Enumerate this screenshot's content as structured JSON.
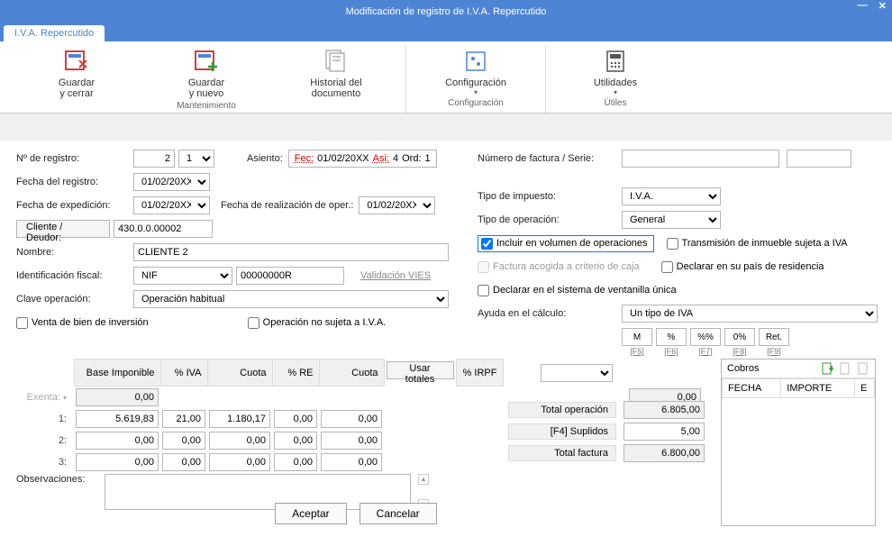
{
  "window": {
    "title": "Modificación de registro de I.V.A. Repercutido"
  },
  "tab": "I.V.A. Repercutido",
  "ribbon": {
    "mantenimiento": {
      "label": "Mantenimiento",
      "items": [
        {
          "l1": "Guardar",
          "l2": "y cerrar"
        },
        {
          "l1": "Guardar",
          "l2": "y nuevo"
        },
        {
          "l1": "Historial del",
          "l2": "documento"
        }
      ]
    },
    "config": {
      "label": "Configuración",
      "item": "Configuración"
    },
    "utiles": {
      "label": "Útiles",
      "item": "Utilidades"
    }
  },
  "form": {
    "nregistro_label": "Nº de registro:",
    "nregistro": "2",
    "nregistro_sub": "1",
    "asiento_label": "Asiento:",
    "asiento_fec_lbl": "Fec:",
    "asiento_fec": "01/02/20XX",
    "asiento_asi_lbl": "Asi:",
    "asiento_asi": "4",
    "asiento_ord_lbl": "Ord:",
    "asiento_ord": "1",
    "fecha_registro_label": "Fecha del registro:",
    "fecha_registro": "01/02/20XX",
    "fecha_exp_label": "Fecha de expedición:",
    "fecha_exp": "01/02/20XX",
    "fecha_oper_label": "Fecha de realización de oper.:",
    "fecha_oper": "01/02/20XX",
    "cliente_btn": "Cliente / Deudor:",
    "cliente_code": "430.0.0.00002",
    "nombre_label": "Nombre:",
    "nombre": "CLIENTE 2",
    "idfiscal_label": "Identificación fiscal:",
    "idfiscal_type": "NIF",
    "idfiscal_num": "00000000R",
    "validacion": "Validación VIES",
    "clave_label": "Clave operación:",
    "clave": "Operación habitual",
    "venta_bien": "Venta de bien de inversión",
    "op_no_sujeta": "Operación no sujeta a I.V.A.",
    "numfact_label": "Número de factura / Serie:",
    "tipo_imp_label": "Tipo de impuesto:",
    "tipo_imp": "I.V.A.",
    "tipo_op_label": "Tipo de operación:",
    "tipo_op": "General",
    "incluir_vol": "Incluir en volumen de operaciones",
    "transmision": "Transmisión de inmueble sujeta a IVA",
    "criterio_caja": "Factura acogida a criterio de caja",
    "declarar_pais": "Declarar en su país de residencia",
    "ventanilla": "Declarar en el sistema de ventanilla única",
    "ayuda_label": "Ayuda en el cálculo:",
    "ayuda": "Un tipo de IVA",
    "calcbtns": [
      "M",
      "%",
      "%%",
      "0%",
      "Ret."
    ],
    "calchints": [
      "[F5]",
      "[F6]",
      "[F7]",
      "[F8]",
      "[F9]"
    ]
  },
  "grid": {
    "headers": [
      "Base Imponible",
      "% IVA",
      "Cuota",
      "% RE",
      "Cuota"
    ],
    "usar_totales": "Usar totales",
    "irpf_label": "% IRPF",
    "row_labels": [
      "Exenta:",
      "1:",
      "2:",
      "3:"
    ],
    "rows": [
      {
        "base": "0,00"
      },
      {
        "base": "5.619,83",
        "pct": "21,00",
        "cuota": "1.180,17",
        "re": "0,00",
        "cuotare": "0,00"
      },
      {
        "base": "0,00",
        "pct": "0,00",
        "cuota": "0,00",
        "re": "0,00",
        "cuotare": "0,00"
      },
      {
        "base": "0,00",
        "pct": "0,00",
        "cuota": "0,00",
        "re": "0,00",
        "cuotare": "0,00"
      }
    ],
    "irpf_val": "0,00"
  },
  "totals": {
    "total_op_label": "Total operación",
    "total_op": "6.805,00",
    "suplidos_label": "[F4] Suplidos",
    "suplidos": "5,00",
    "total_fact_label": "Total factura",
    "total_fact": "6.800,00"
  },
  "cobros": {
    "title": "Cobros",
    "cols": [
      "FECHA",
      "IMPORTE",
      "E"
    ]
  },
  "obs": {
    "label": "Observaciones:"
  },
  "buttons": {
    "ok": "Aceptar",
    "cancel": "Cancelar"
  }
}
